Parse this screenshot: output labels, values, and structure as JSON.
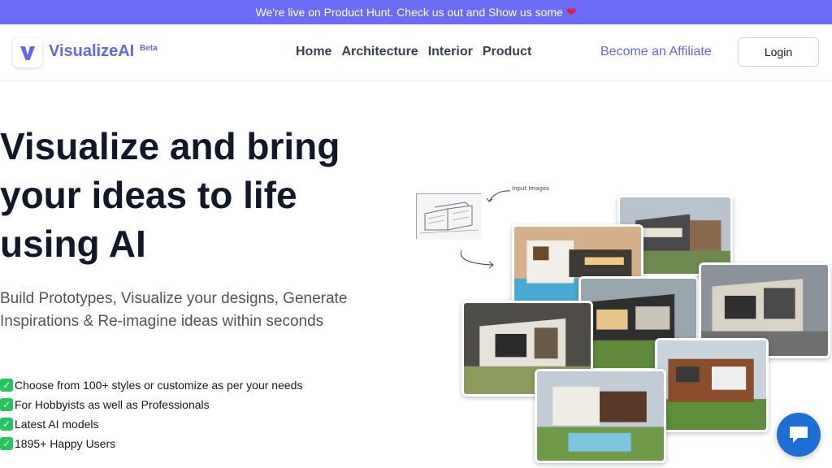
{
  "banner": {
    "text": "We're live on Product Hunt. Check us out and Show us some",
    "heart_icon": "heart-icon"
  },
  "nav": {
    "logo_icon": "v-logo-icon",
    "brand": "VisualizeAI",
    "badge": "Beta",
    "links": [
      "Home",
      "Architecture",
      "Interior",
      "Product"
    ],
    "affiliate": "Become an Affiliate",
    "login": "Login"
  },
  "hero": {
    "title_lines": [
      "Visualize and bring",
      "your ideas to life",
      "using AI"
    ],
    "subtitle": "Build Prototypes, Visualize your designs, Generate Inspirations & Re-imagine ideas within seconds",
    "features": [
      "Choose from 100+ styles or customize as per your needs",
      "For Hobbyists as well as Professionals",
      "Latest AI models",
      "1895+ Happy Users"
    ],
    "check_icon": "check-box-icon"
  },
  "gallery": {
    "input_label": "Input Images"
  },
  "chat": {
    "icon": "chat-bubble-icon"
  },
  "colors": {
    "accent": "#6366f1",
    "banner": "#6b6cf6",
    "chat": "#1d6fd6",
    "check": "#22c55e"
  }
}
